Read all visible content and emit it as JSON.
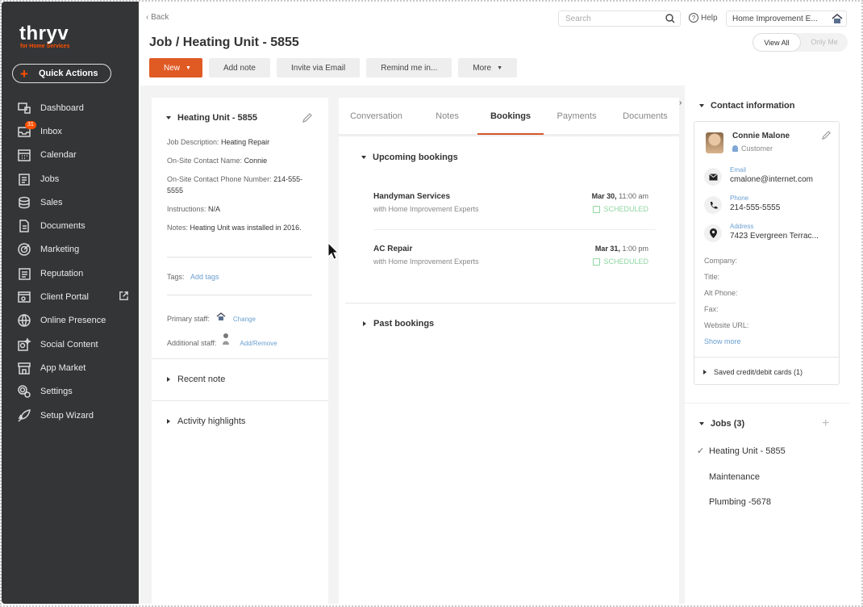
{
  "brand": {
    "logo": "thryv",
    "sub": "for Home Services",
    "accent": "#ff5000"
  },
  "sidebar": {
    "quick_actions": "Quick Actions",
    "items": [
      {
        "label": "Dashboard",
        "icon": "dashboard-icon"
      },
      {
        "label": "Inbox",
        "icon": "inbox-icon",
        "badge": "31"
      },
      {
        "label": "Calendar",
        "icon": "calendar-icon"
      },
      {
        "label": "Jobs",
        "icon": "jobs-icon"
      },
      {
        "label": "Sales",
        "icon": "sales-icon"
      },
      {
        "label": "Documents",
        "icon": "documents-icon"
      },
      {
        "label": "Marketing",
        "icon": "marketing-icon"
      },
      {
        "label": "Reputation",
        "icon": "reputation-icon"
      },
      {
        "label": "Client Portal",
        "icon": "client-portal-icon"
      },
      {
        "label": "Online Presence",
        "icon": "globe-icon"
      },
      {
        "label": "Social Content",
        "icon": "social-content-icon"
      },
      {
        "label": "App Market",
        "icon": "app-market-icon"
      },
      {
        "label": "Settings",
        "icon": "settings-icon"
      },
      {
        "label": "Setup Wizard",
        "icon": "rocket-icon"
      }
    ]
  },
  "topbar": {
    "back": "Back",
    "search_placeholder": "Search",
    "help": "Help",
    "account": "Home Improvement E..."
  },
  "page": {
    "title": "Job / Heating Unit - 5855",
    "view_all": "View All",
    "only_me": "Only Me"
  },
  "toolbar": {
    "new": "New",
    "add_note": "Add note",
    "invite_email": "Invite via Email",
    "remind": "Remind me in...",
    "more": "More"
  },
  "job": {
    "title": "Heating Unit - 5855",
    "desc_label": "Job Description:",
    "desc": "Heating Repair",
    "contact_label": "On-Site Contact Name:",
    "contact": "Connie",
    "phone_label": "On-Site Contact Phone Number:",
    "phone": "214-555-5555",
    "instr_label": "Instructions:",
    "instr": "N/A",
    "notes_label": "Notes:",
    "notes": "Heating Unit was installed in 2016.",
    "tags_label": "Tags:",
    "add_tags": "Add tags",
    "primary_label": "Primary staff:",
    "change": "Change",
    "additional_label": "Additional staff:",
    "add_remove": "Add/Remove",
    "recent_note": "Recent note",
    "activity": "Activity highlights"
  },
  "tabs": [
    "Conversation",
    "Notes",
    "Bookings",
    "Payments",
    "Documents"
  ],
  "bookings": {
    "upcoming": "Upcoming bookings",
    "past": "Past bookings",
    "items": [
      {
        "name": "Handyman Services",
        "with": "with Home Improvement Experts",
        "date": "Mar 30,",
        "time": "11:00 am",
        "status": "SCHEDULED"
      },
      {
        "name": "AC Repair",
        "with": "with Home Improvement Experts",
        "date": "Mar 31,",
        "time": "1:00 pm",
        "status": "SCHEDULED"
      }
    ]
  },
  "contact": {
    "section": "Contact information",
    "name": "Connie Malone",
    "role": "Customer",
    "email_label": "Email",
    "email": "cmalone@internet.com",
    "phone_label": "Phone",
    "phone": "214-555-5555",
    "address_label": "Address",
    "address": "7423 Evergreen Terrac...",
    "company": "Company:",
    "title": "Title:",
    "alt_phone": "Alt Phone:",
    "fax": "Fax:",
    "website": "Website URL:",
    "show_more": "Show more",
    "saved_cards": "Saved credit/debit cards (1)"
  },
  "jobs": {
    "title": "Jobs (3)",
    "items": [
      "Heating Unit - 5855",
      "Maintenance",
      "Plumbing -5678"
    ]
  }
}
